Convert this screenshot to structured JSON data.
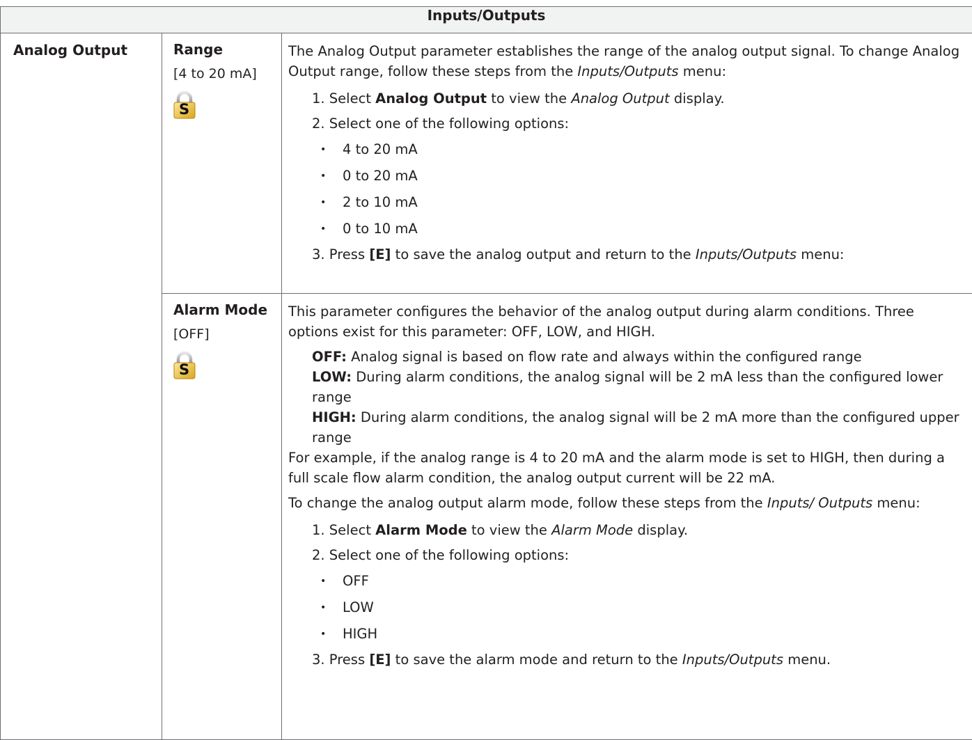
{
  "header": "Inputs/Outputs",
  "parameter": "Analog Output",
  "range": {
    "name": "Range",
    "default": "[4 to 20 mA]",
    "lock_label": "S",
    "intro": "The Analog Output parameter establishes the range of the analog output signal. To change Analog Output range, follow these steps from the ",
    "intro_menu": "Inputs/Outputs",
    "intro_end": " menu:",
    "step1_pre": "1. Select ",
    "step1_bold": "Analog Output",
    "step1_mid": " to view the ",
    "step1_ital": "Analog Output",
    "step1_end": " display.",
    "step2": "2. Select one of the following options:",
    "options": [
      "4 to 20 mA",
      "0 to 20 mA",
      "2 to 10 mA",
      "0 to 10 mA"
    ],
    "step3_pre": "3. Press ",
    "step3_bold": "[E]",
    "step3_mid": " to save the analog output and return to the ",
    "step3_ital": "Inputs/Outputs",
    "step3_end": " menu:"
  },
  "alarm": {
    "name": "Alarm Mode",
    "default": "[OFF]",
    "lock_label": "S",
    "intro": "This parameter configures the behavior of the analog output during alarm conditions. Three options exist for this parameter: OFF, LOW, and HIGH.",
    "off_label": "OFF:",
    "off_text": " Analog signal is based on flow rate and always within the configured range",
    "low_label": "LOW:",
    "low_text": " During alarm conditions, the analog signal will be 2 mA less than the configured lower range",
    "high_label": "HIGH:",
    "high_text": " During alarm conditions, the analog signal will be 2 mA more than the configured upper range",
    "example": "For example, if the analog range is 4 to 20 mA and the alarm mode is set to HIGH, then during a full scale flow alarm condition, the analog output current will be 22 mA.",
    "change_pre": "To change the analog output alarm mode, follow these steps from the ",
    "change_ital": "Inputs/ Outputs",
    "change_end": " menu:",
    "step1_pre": "1. Select ",
    "step1_bold": "Alarm Mode",
    "step1_mid": " to view the ",
    "step1_ital": "Alarm Mode",
    "step1_end": " display.",
    "step2": "2. Select one of the following options:",
    "options": [
      "OFF",
      "LOW",
      "HIGH"
    ],
    "step3_pre": "3. Press ",
    "step3_bold": "[E]",
    "step3_mid": " to save the alarm mode and return to the ",
    "step3_ital": "Inputs/Outputs",
    "step3_end": " menu."
  }
}
